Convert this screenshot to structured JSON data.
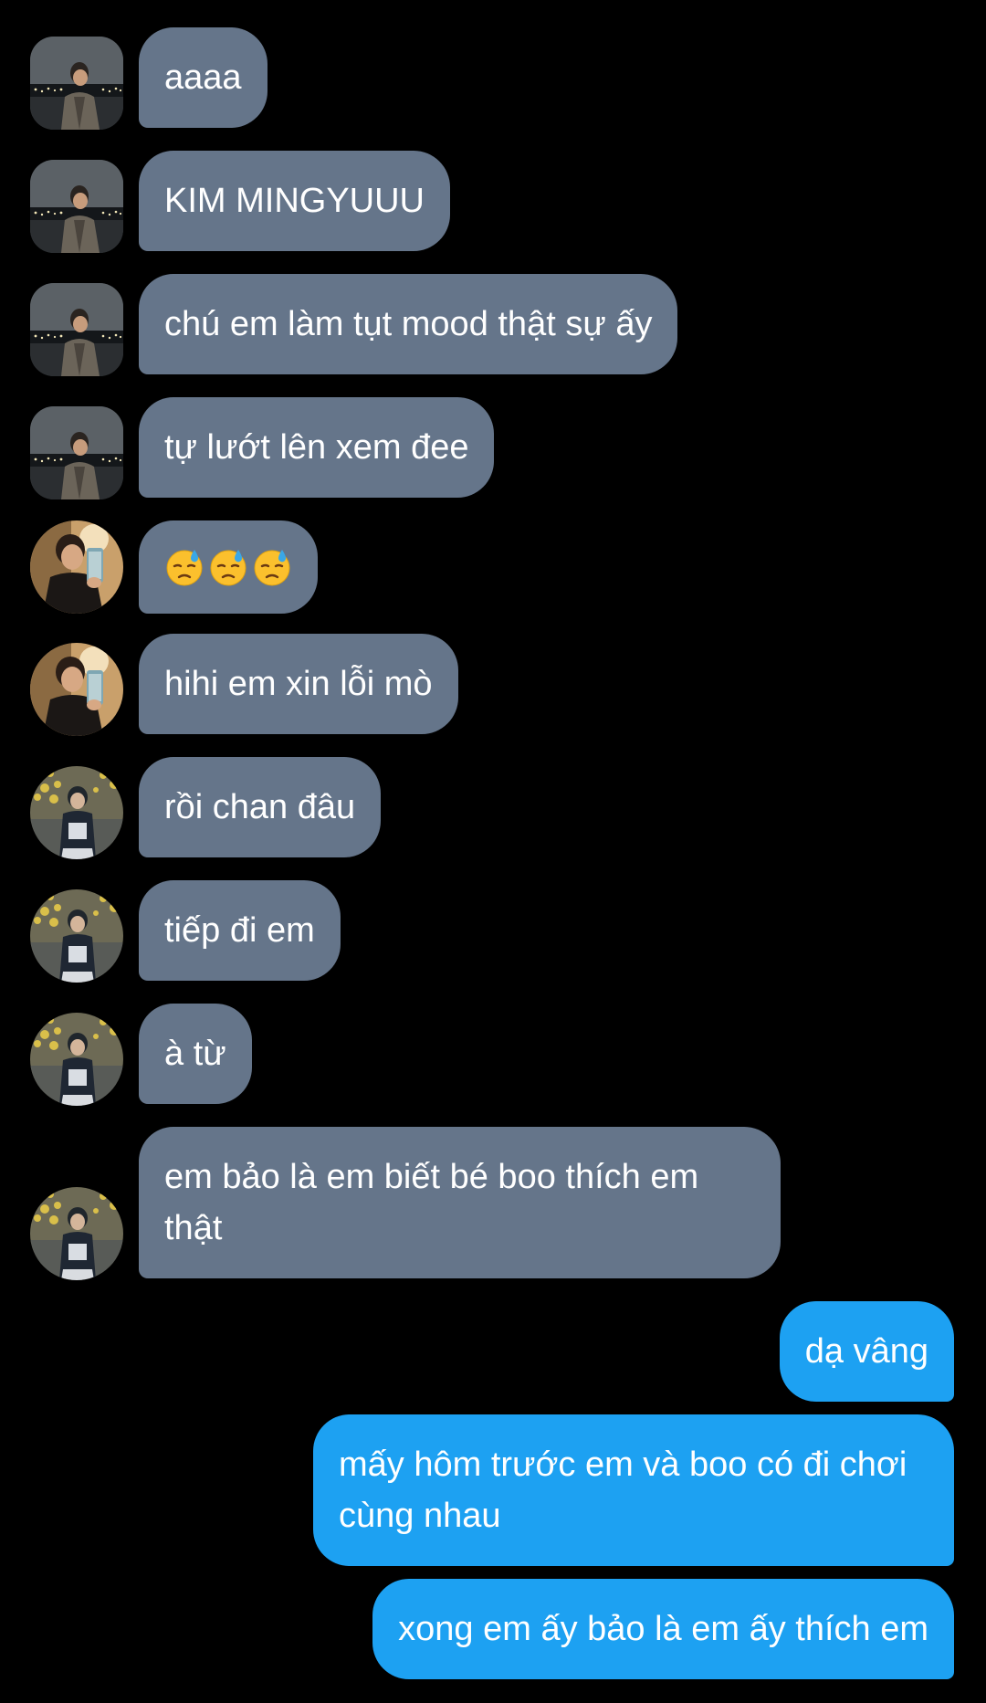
{
  "conversation": {
    "messages": [
      {
        "from": "other",
        "avatar": "avatar-night-city",
        "text": "aaaa"
      },
      {
        "from": "other",
        "avatar": "avatar-night-city",
        "text": "KIM MINGYUUU"
      },
      {
        "from": "other",
        "avatar": "avatar-night-city",
        "text": "chú em làm tụt mood thật sự ấy"
      },
      {
        "from": "other",
        "avatar": "avatar-night-city",
        "text": "tự lướt lên xem đee"
      },
      {
        "from": "other",
        "avatar": "avatar-reading-guy",
        "emoji": [
          "downcast-face-with-sweat",
          "downcast-face-with-sweat",
          "downcast-face-with-sweat"
        ]
      },
      {
        "from": "other",
        "avatar": "avatar-reading-guy",
        "text": "hihi em xin lỗi mò"
      },
      {
        "from": "other",
        "avatar": "avatar-yellow-flowers",
        "text": "rồi chan đâu"
      },
      {
        "from": "other",
        "avatar": "avatar-yellow-flowers",
        "text": "tiếp đi em"
      },
      {
        "from": "other",
        "avatar": "avatar-yellow-flowers",
        "text": "à từ"
      },
      {
        "from": "other",
        "avatar": "avatar-yellow-flowers",
        "text": "em bảo là em biết bé boo thích em thật"
      },
      {
        "from": "me",
        "text": "dạ vâng"
      },
      {
        "from": "me",
        "text": "mấy hôm trước em và boo có đi chơi cùng nhau"
      },
      {
        "from": "me",
        "text": "xong em ấy bảo là em ấy thích em"
      }
    ]
  },
  "colors": {
    "background": "#000000",
    "incoming_bubble": "#65758a",
    "outgoing_bubble": "#1da1f2",
    "text": "#ffffff"
  }
}
